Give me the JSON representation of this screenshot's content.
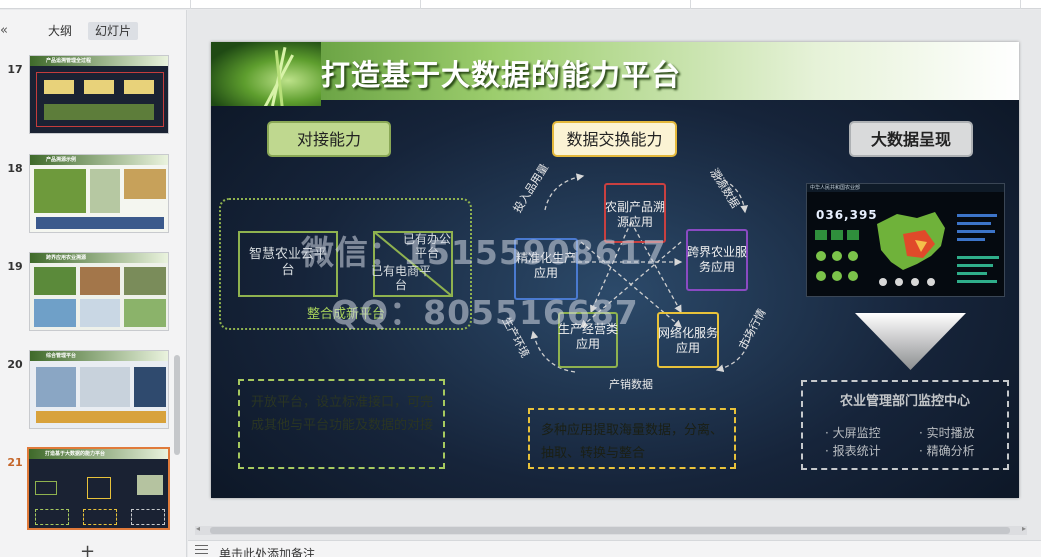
{
  "panel": {
    "collapse_icon": "«",
    "tabs": [
      {
        "label": "大纲"
      },
      {
        "label": "幻灯片"
      }
    ],
    "slides": [
      {
        "number": "17",
        "title": "产品追溯管理全过程"
      },
      {
        "number": "18",
        "title": "产品溯源示例"
      },
      {
        "number": "19",
        "title": "跨界应用农业溯源"
      },
      {
        "number": "20",
        "title": "综合管理平台"
      },
      {
        "number": "21",
        "title": "打造基于大数据的能力平台"
      }
    ],
    "add_slide": "+"
  },
  "slide": {
    "title": "打造基于大数据的能力平台",
    "headers": [
      "对接能力",
      "数据交换能力",
      "大数据呈现"
    ],
    "left": {
      "box_a": "智慧农业云平台",
      "box_b_top": "已有办公平台",
      "box_b_bottom": "已有电商平台",
      "merge_label": "整合成新平台",
      "desc": "开放平台，设立标准接口，可完成其他与平台功能及数据的对接"
    },
    "center": {
      "puzzle_top": "农副产品溯源应用",
      "puzzle_left": "精准化生产应用",
      "puzzle_right": "跨界农业服务应用",
      "puzzle_bl": "生产经营类应用",
      "puzzle_br": "网络化服务应用",
      "flow_tl": "投入品用量",
      "flow_tr": "溯源数据",
      "flow_l": "生产环境",
      "flow_r": "市场行情",
      "flow_b": "产销数据",
      "desc": "多种应用提取海量数据，分离、抽取、转换与整合"
    },
    "right": {
      "screen_header": "中华人民共和国农业部",
      "screen_number": "036,395",
      "monitor_title": "农业管理部门监控中心",
      "bullets": [
        "大屏监控",
        "实时播放",
        "报表统计",
        "精确分析"
      ]
    },
    "watermark_line1": "微信：15155908617",
    "watermark_line2": "QQ：805516687"
  },
  "notes": {
    "placeholder": "单击此处添加备注"
  },
  "colors": {
    "accent_orange": "#e07a3a",
    "green": "#8fb24f",
    "yellow": "#e8c23a",
    "purple": "#8a4ac2",
    "red": "#c94040"
  }
}
